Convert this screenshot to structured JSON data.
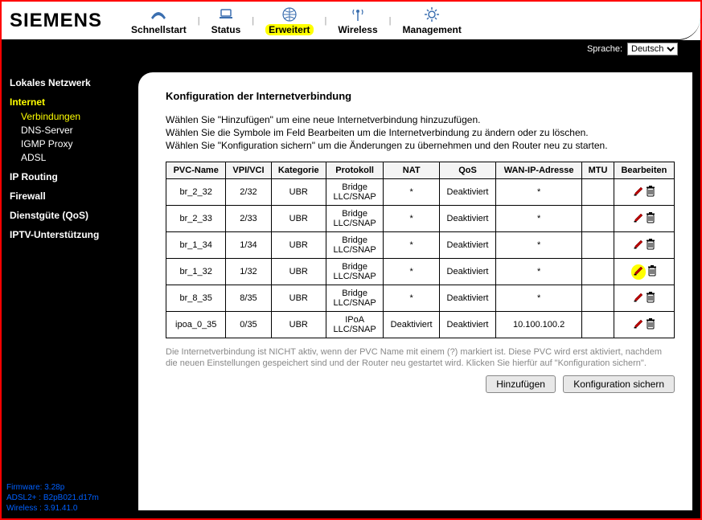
{
  "brand": "SIEMENS",
  "topnav": {
    "items": [
      {
        "label": "Schnellstart",
        "icon": "phone-icon"
      },
      {
        "label": "Status",
        "icon": "laptop-icon"
      },
      {
        "label": "Erweitert",
        "icon": "globe-icon",
        "active": true
      },
      {
        "label": "Wireless",
        "icon": "antenna-icon"
      },
      {
        "label": "Management",
        "icon": "gear-icon"
      }
    ]
  },
  "language": {
    "label": "Sprache:",
    "selected": "Deutsch"
  },
  "sidebar": {
    "sections": [
      {
        "title": "Lokales Netzwerk"
      },
      {
        "title": "Internet",
        "active": true,
        "subs": [
          {
            "label": "Verbindungen",
            "active": true
          },
          {
            "label": "DNS-Server"
          },
          {
            "label": "IGMP Proxy"
          },
          {
            "label": "ADSL"
          }
        ]
      },
      {
        "title": "IP Routing"
      },
      {
        "title": "Firewall"
      },
      {
        "title": "Dienstgüte (QoS)"
      },
      {
        "title": "IPTV-Unterstützung"
      }
    ],
    "footer": {
      "firmware_k": "Firmware:",
      "firmware_v": "3.28p",
      "adsl_k": "ADSL2+ :",
      "adsl_v": "B2pB021.d17m",
      "wireless_k": "Wireless :",
      "wireless_v": "3.91.41.0"
    }
  },
  "page": {
    "title": "Konfiguration der Internetverbindung",
    "instr1": "Wählen Sie \"Hinzufügen\" um eine neue Internetverbindung hinzuzufügen.",
    "instr2": "Wählen Sie die Symbole im Feld Bearbeiten um die Internetverbindung zu ändern oder zu löschen.",
    "instr3": "Wählen Sie \"Konfiguration sichern\" um die Änderungen zu übernehmen und den Router neu zu starten.",
    "note": "Die Internetverbindung ist NICHT aktiv, wenn der PVC Name mit einem (?) markiert ist. Diese PVC wird erst aktiviert, nachdem die neuen Einstellungen gespeichert sind und der Router neu gestartet wird. Klicken Sie hierfür auf \"Konfiguration sichern\".",
    "btn_add": "Hinzufügen",
    "btn_save": "Konfiguration sichern"
  },
  "table": {
    "headers": {
      "pvc": "PVC-Name",
      "vpi": "VPI/VCI",
      "kat": "Kategorie",
      "proto": "Protokoll",
      "nat": "NAT",
      "qos": "QoS",
      "wan": "WAN-IP-Adresse",
      "mtu": "MTU",
      "edit": "Bearbeiten"
    },
    "rows": [
      {
        "pvc": "br_2_32",
        "vpi": "2/32",
        "kat": "UBR",
        "proto1": "Bridge",
        "proto2": "LLC/SNAP",
        "nat": "*",
        "qos": "Deaktiviert",
        "wan": "*",
        "mtu": "",
        "hl": false
      },
      {
        "pvc": "br_2_33",
        "vpi": "2/33",
        "kat": "UBR",
        "proto1": "Bridge",
        "proto2": "LLC/SNAP",
        "nat": "*",
        "qos": "Deaktiviert",
        "wan": "*",
        "mtu": "",
        "hl": false
      },
      {
        "pvc": "br_1_34",
        "vpi": "1/34",
        "kat": "UBR",
        "proto1": "Bridge",
        "proto2": "LLC/SNAP",
        "nat": "*",
        "qos": "Deaktiviert",
        "wan": "*",
        "mtu": "",
        "hl": false
      },
      {
        "pvc": "br_1_32",
        "vpi": "1/32",
        "kat": "UBR",
        "proto1": "Bridge",
        "proto2": "LLC/SNAP",
        "nat": "*",
        "qos": "Deaktiviert",
        "wan": "*",
        "mtu": "",
        "hl": true
      },
      {
        "pvc": "br_8_35",
        "vpi": "8/35",
        "kat": "UBR",
        "proto1": "Bridge",
        "proto2": "LLC/SNAP",
        "nat": "*",
        "qos": "Deaktiviert",
        "wan": "*",
        "mtu": "",
        "hl": false
      },
      {
        "pvc": "ipoa_0_35",
        "vpi": "0/35",
        "kat": "UBR",
        "proto1": "IPoA",
        "proto2": "LLC/SNAP",
        "nat": "Deaktiviert",
        "qos": "Deaktiviert",
        "wan": "10.100.100.2",
        "mtu": "",
        "hl": false
      }
    ]
  }
}
